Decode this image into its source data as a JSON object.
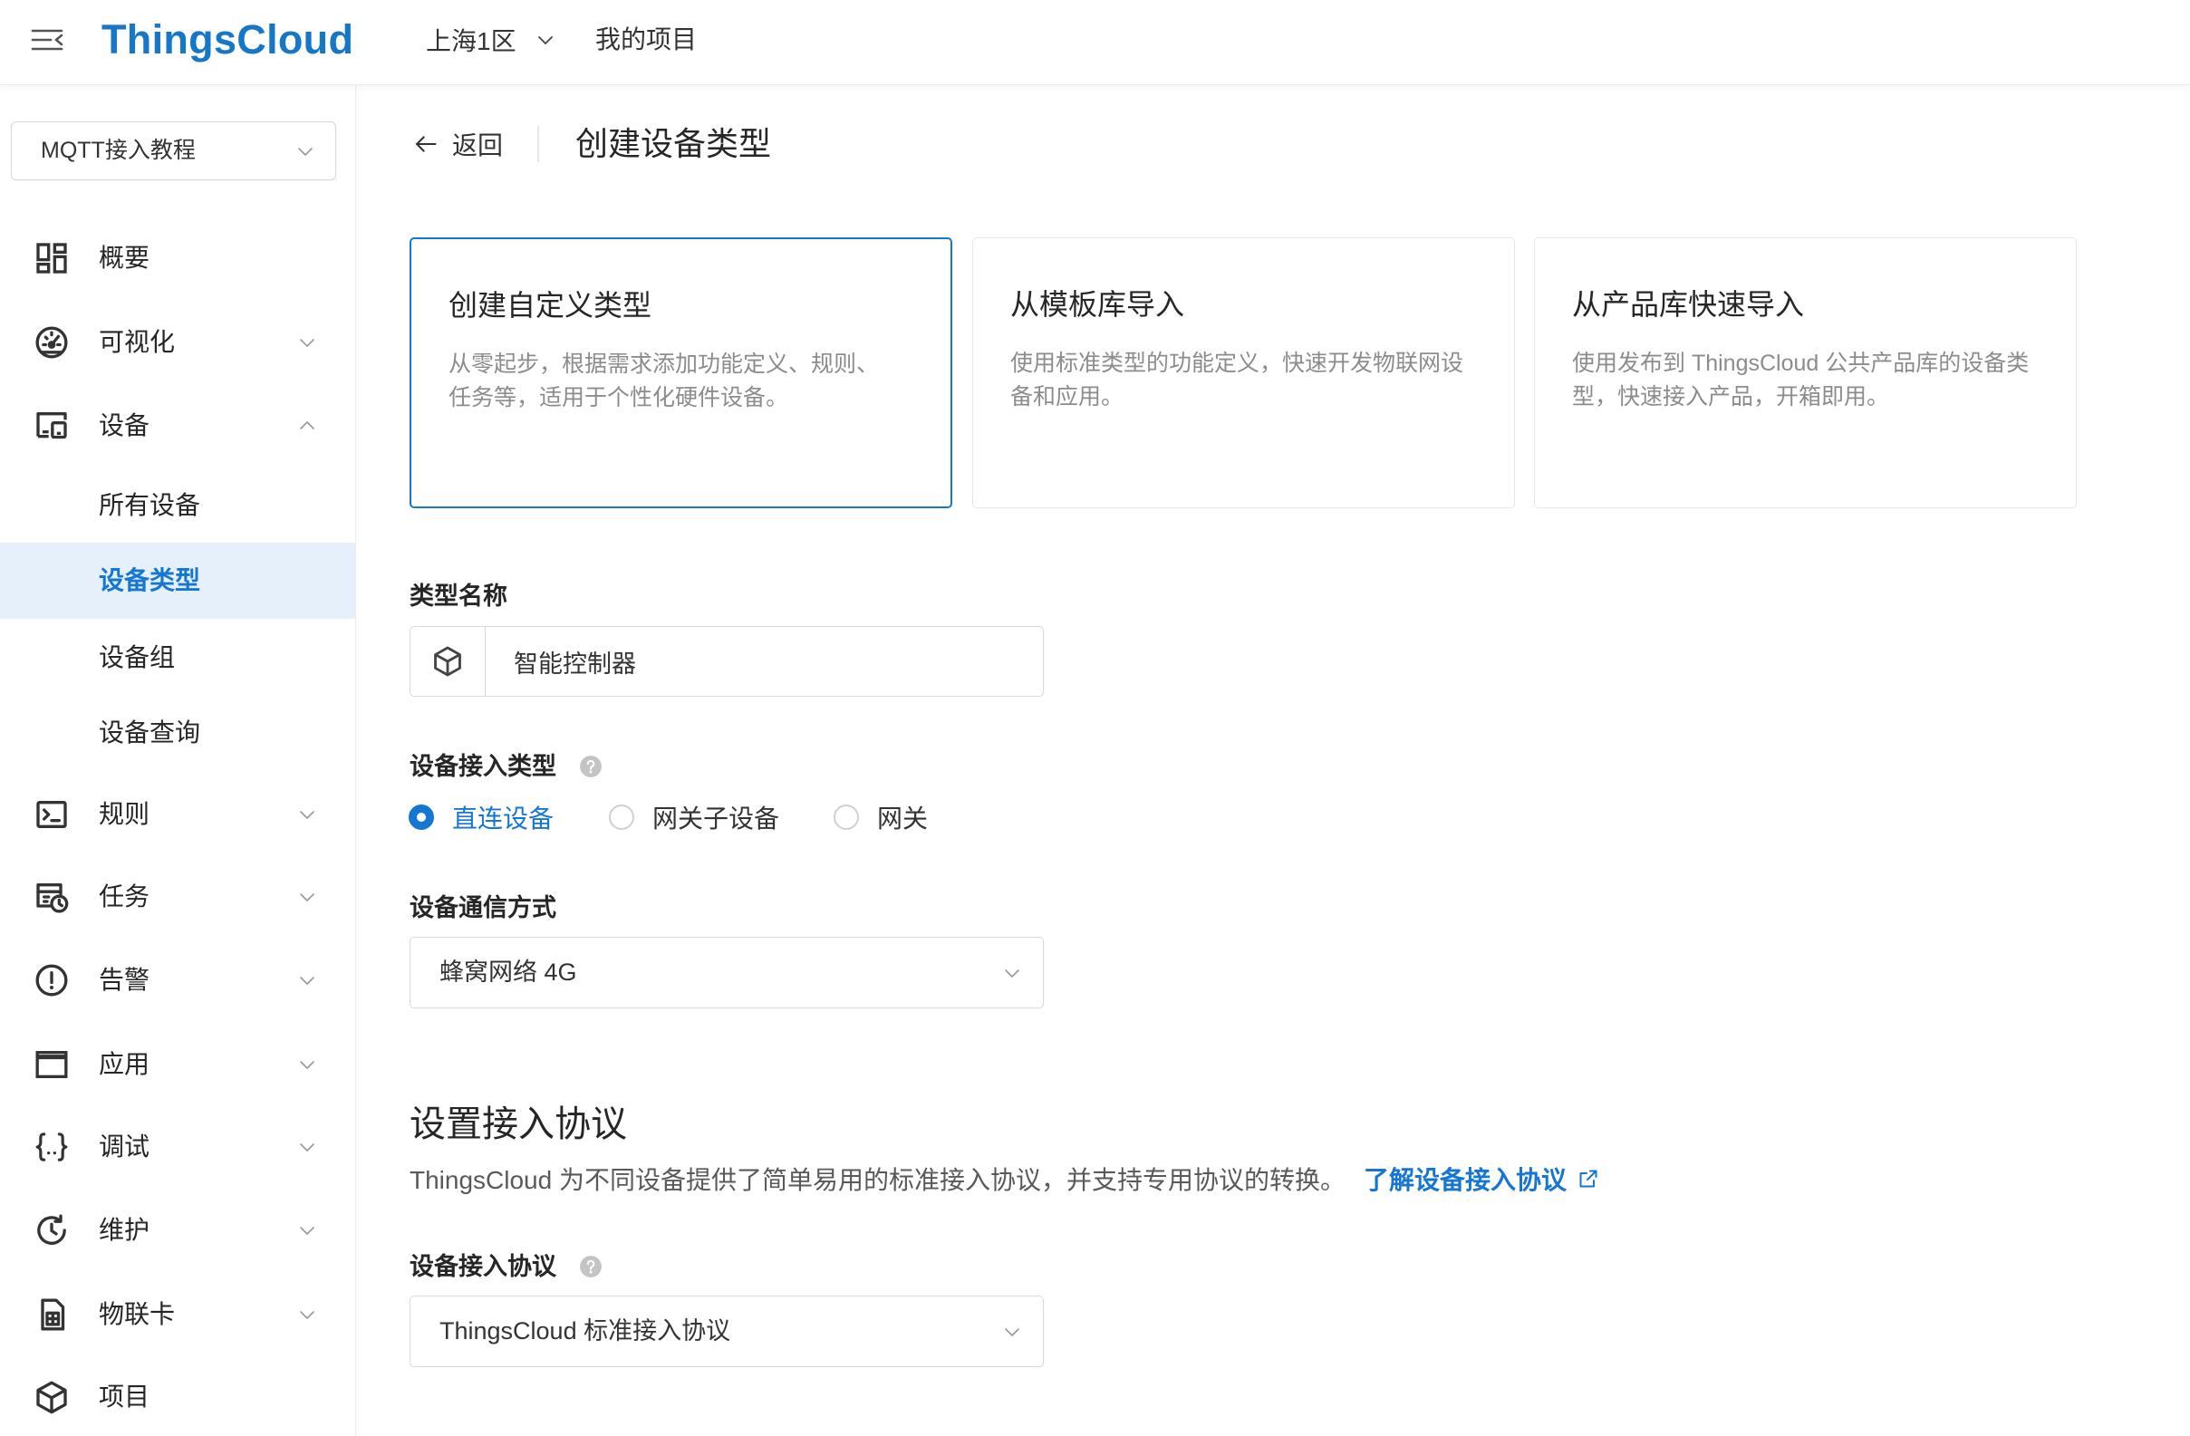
{
  "colors": {
    "accent": "#1677d2",
    "logo": "#1677c8",
    "active_bg": "#e6f0fb",
    "text": "#262626",
    "muted": "#8c8c8c"
  },
  "header": {
    "logo": "ThingsCloud",
    "region": "上海1区",
    "projects_link": "我的项目"
  },
  "sidebar": {
    "project_select": "MQTT接入教程",
    "items": [
      {
        "label": "概要",
        "icon": "dashboard-icon"
      },
      {
        "label": "可视化",
        "icon": "gauge-icon"
      },
      {
        "label": "设备",
        "icon": "device-icon",
        "expanded": true,
        "children": [
          {
            "label": "所有设备"
          },
          {
            "label": "设备类型",
            "active": true
          },
          {
            "label": "设备组"
          },
          {
            "label": "设备查询"
          }
        ]
      },
      {
        "label": "规则",
        "icon": "terminal-icon"
      },
      {
        "label": "任务",
        "icon": "task-icon"
      },
      {
        "label": "告警",
        "icon": "alert-icon"
      },
      {
        "label": "应用",
        "icon": "window-icon"
      },
      {
        "label": "调试",
        "icon": "braces-icon"
      },
      {
        "label": "维护",
        "icon": "maintenance-icon"
      },
      {
        "label": "物联卡",
        "icon": "sim-card-icon"
      },
      {
        "label": "项目",
        "icon": "cube-icon"
      }
    ]
  },
  "page": {
    "back": "返回",
    "title": "创建设备类型"
  },
  "create_options": [
    {
      "title": "创建自定义类型",
      "description": "从零起步，根据需求添加功能定义、规则、任务等，适用于个性化硬件设备。",
      "selected": true
    },
    {
      "title": "从模板库导入",
      "description": "使用标准类型的功能定义，快速开发物联网设备和应用。",
      "selected": false
    },
    {
      "title": "从产品库快速导入",
      "description": "使用发布到 ThingsCloud 公共产品库的设备类型，快速接入产品，开箱即用。",
      "selected": false
    }
  ],
  "form": {
    "type_name": {
      "label": "类型名称",
      "value": "智能控制器"
    },
    "access_type": {
      "label": "设备接入类型",
      "options": [
        "直连设备",
        "网关子设备",
        "网关"
      ],
      "selected": "直连设备"
    },
    "communication": {
      "label": "设备通信方式",
      "value": "蜂窝网络 4G"
    }
  },
  "protocol_section": {
    "title": "设置接入协议",
    "description": "ThingsCloud 为不同设备提供了简单易用的标准接入协议，并支持专用协议的转换。",
    "link": "了解设备接入协议",
    "protocol": {
      "label": "设备接入协议",
      "value": "ThingsCloud 标准接入协议"
    }
  }
}
